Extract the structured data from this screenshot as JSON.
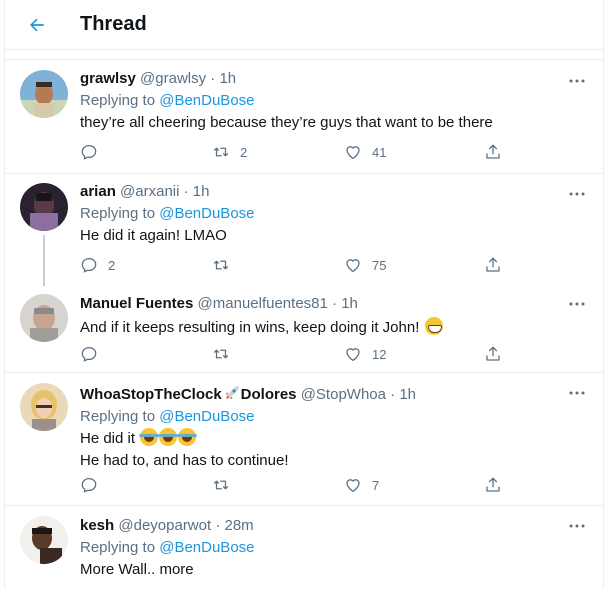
{
  "header": {
    "title": "Thread",
    "back_icon": "arrow-left-icon"
  },
  "colors": {
    "accent": "#1b95e0",
    "muted": "#5b7083",
    "border": "#ebeef0"
  },
  "tweets": [
    {
      "name": "grawlsy",
      "handle": "@grawlsy",
      "sep": "·",
      "time": "1h",
      "replying_prefix": "Replying to",
      "replying_to": "@BenDuBose",
      "text": "they’re all cheering because they’re guys that want to be there",
      "reply_count": "",
      "retweet_count": "2",
      "like_count": "41"
    },
    {
      "name": "arian",
      "handle": "@arxanii",
      "sep": "·",
      "time": "1h",
      "replying_prefix": "Replying to",
      "replying_to": "@BenDuBose",
      "text": "He did it again! LMAO",
      "reply_count": "2",
      "retweet_count": "",
      "like_count": "75"
    },
    {
      "name": "Manuel Fuentes",
      "handle": "@manuelfuentes81",
      "sep": "·",
      "time": "1h",
      "text": "And if it keeps resulting in wins, keep doing it John!",
      "emoji": "grinning-emoji",
      "reply_count": "",
      "retweet_count": "",
      "like_count": "12"
    },
    {
      "name_a": "WhoaStopTheClock",
      "name_b": "Dolores",
      "name_emoji": "rocket-emoji",
      "handle": "@StopWhoa",
      "sep": "·",
      "time": "1h",
      "replying_prefix": "Replying to",
      "replying_to": "@BenDuBose",
      "text_line1": "He did it",
      "text_line1_emoji": "tears-of-joy-emoji",
      "text_line2": "He had to, and has to continue!",
      "reply_count": "",
      "retweet_count": "",
      "like_count": "7"
    },
    {
      "name": "kesh",
      "handle": "@deyoparwot",
      "sep": "·",
      "time": "28m",
      "replying_prefix": "Replying to",
      "replying_to": "@BenDuBose",
      "text": "More Wall.. more"
    }
  ]
}
